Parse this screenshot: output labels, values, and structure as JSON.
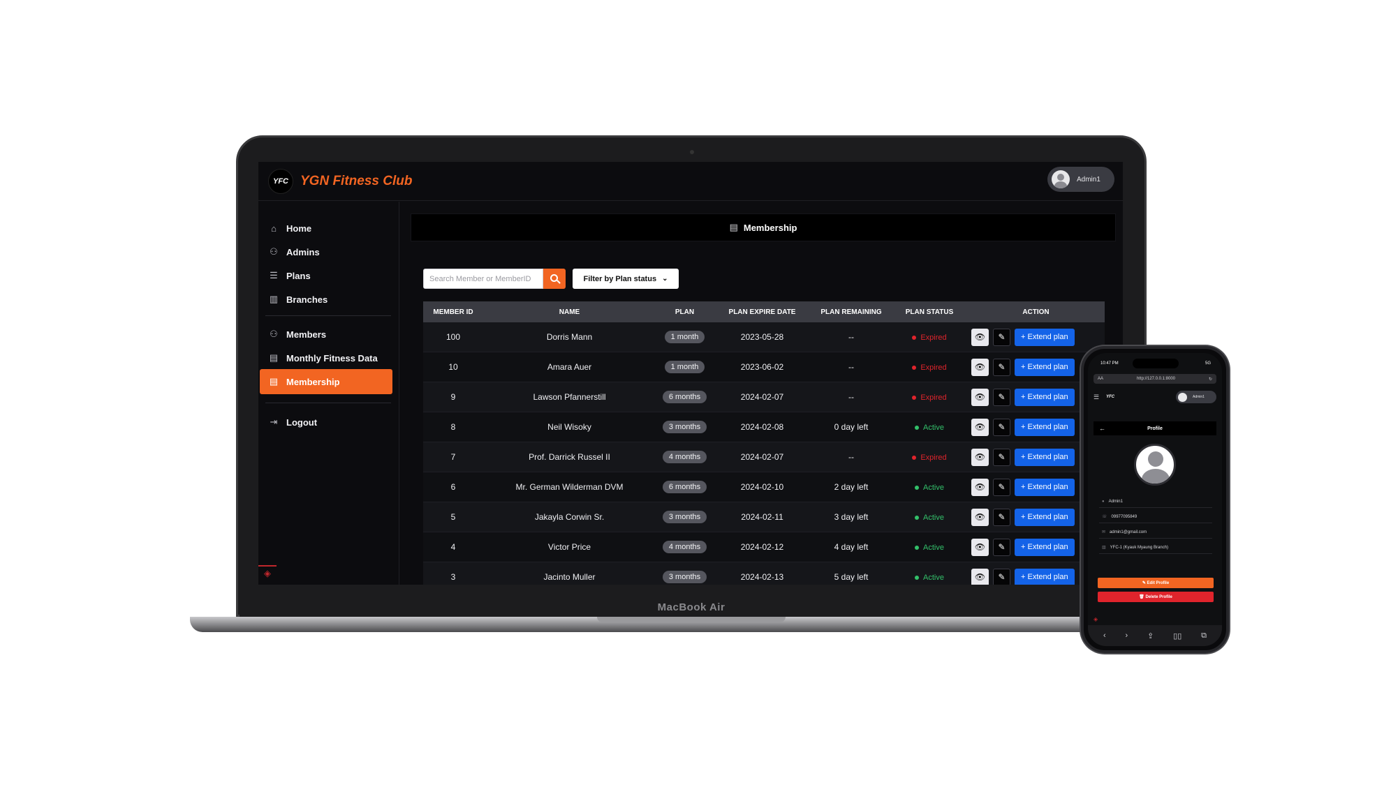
{
  "app": {
    "brand": "YGN Fitness Club",
    "logo_text": "YFC",
    "user_name": "Admin1"
  },
  "device": {
    "laptop_label": "MacBook Air"
  },
  "sidebar": {
    "items": [
      {
        "label": "Home",
        "icon": "home-icon"
      },
      {
        "label": "Admins",
        "icon": "admins-icon"
      },
      {
        "label": "Plans",
        "icon": "list-icon"
      },
      {
        "label": "Branches",
        "icon": "building-icon"
      },
      {
        "label": "Members",
        "icon": "members-icon"
      },
      {
        "label": "Monthly Fitness Data",
        "icon": "calendar-icon"
      },
      {
        "label": "Membership",
        "icon": "membership-icon",
        "active": true
      },
      {
        "label": "Logout",
        "icon": "logout-icon"
      }
    ]
  },
  "main": {
    "header_title": "Membership",
    "search": {
      "placeholder": "Search Member or MemberID",
      "value": ""
    },
    "filter_label": "Filter by Plan status",
    "columns": [
      "MEMBER ID",
      "NAME",
      "PLAN",
      "PLAN EXPIRE DATE",
      "PLAN REMAINING",
      "PLAN STATUS",
      "ACTION"
    ],
    "rows": [
      {
        "id": "100",
        "name": "Dorris Mann",
        "plan": "1 month",
        "expire": "2023-05-28",
        "remaining": "--",
        "status": "Expired"
      },
      {
        "id": "10",
        "name": "Amara Auer",
        "plan": "1 month",
        "expire": "2023-06-02",
        "remaining": "--",
        "status": "Expired"
      },
      {
        "id": "9",
        "name": "Lawson Pfannerstill",
        "plan": "6 months",
        "expire": "2024-02-07",
        "remaining": "--",
        "status": "Expired"
      },
      {
        "id": "8",
        "name": "Neil Wisoky",
        "plan": "3 months",
        "expire": "2024-02-08",
        "remaining": "0 day left",
        "status": "Active"
      },
      {
        "id": "7",
        "name": "Prof. Darrick Russel II",
        "plan": "4 months",
        "expire": "2024-02-07",
        "remaining": "--",
        "status": "Expired"
      },
      {
        "id": "6",
        "name": "Mr. German Wilderman DVM",
        "plan": "6 months",
        "expire": "2024-02-10",
        "remaining": "2 day left",
        "status": "Active"
      },
      {
        "id": "5",
        "name": "Jakayla Corwin Sr.",
        "plan": "3 months",
        "expire": "2024-02-11",
        "remaining": "3 day left",
        "status": "Active"
      },
      {
        "id": "4",
        "name": "Victor Price",
        "plan": "4 months",
        "expire": "2024-02-12",
        "remaining": "4 day left",
        "status": "Active"
      },
      {
        "id": "3",
        "name": "Jacinto Muller",
        "plan": "3 months",
        "expire": "2024-02-13",
        "remaining": "5 day left",
        "status": "Active"
      }
    ],
    "extend_label": "+ Extend plan"
  },
  "phone": {
    "time": "10:47 PM",
    "signal": "5G",
    "url": "http://127.0.0.1:8000",
    "url_prefix": "AA",
    "user_name": "Admin1",
    "header_title": "Profile",
    "fields": [
      {
        "icon": "user-icon",
        "value": "Admin1"
      },
      {
        "icon": "phone-icon",
        "value": "09977095849"
      },
      {
        "icon": "mail-icon",
        "value": "admin1@gmail.com"
      },
      {
        "icon": "building-icon",
        "value": "YFC-1 (Kyauk Myaung Branch)"
      }
    ],
    "edit_label": "Edit Profile",
    "delete_label": "Delete Profile"
  },
  "colors": {
    "accent": "#f26522",
    "expired": "#e0242c",
    "active": "#33c06a",
    "extend": "#1463e8",
    "background": "#0c0c0f"
  }
}
